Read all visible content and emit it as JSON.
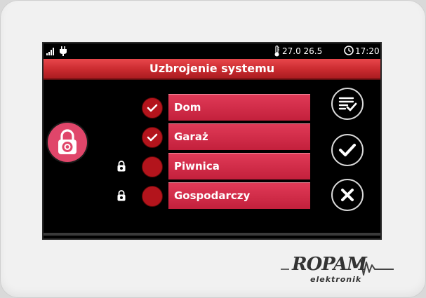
{
  "statusbar": {
    "temperature": "27.0 26.5",
    "time": "17:20"
  },
  "title": "Uzbrojenie systemu",
  "zones": [
    {
      "name": "Dom",
      "checked": true,
      "locked": false
    },
    {
      "name": "Garaż",
      "checked": true,
      "locked": false
    },
    {
      "name": "Piwnica",
      "checked": false,
      "locked": true
    },
    {
      "name": "Gospodarczy",
      "checked": false,
      "locked": true
    }
  ],
  "actions": {
    "select_all_icon": "checklist-icon",
    "confirm_icon": "checkmark-icon",
    "cancel_icon": "close-icon"
  },
  "brand": {
    "name": "ROPAM",
    "sub": "elektronik"
  },
  "colors": {
    "title_bar": "#c92a2f",
    "zone_button": "#d42f4c",
    "lock_circle": "#e0466a",
    "check_circle": "#b3141c"
  }
}
